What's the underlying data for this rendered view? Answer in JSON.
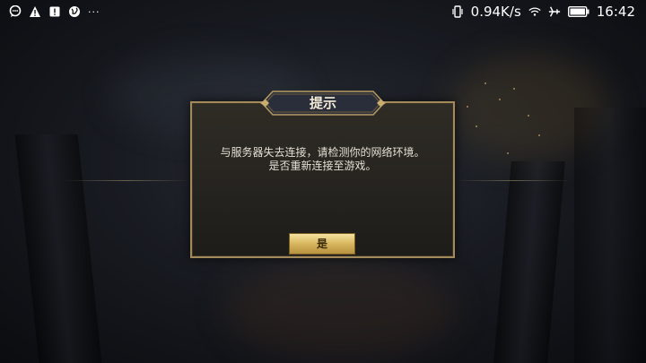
{
  "statusbar": {
    "left_icons": [
      "chat-icon",
      "warning-icon",
      "alert-icon",
      "globe-icon"
    ],
    "more": "···",
    "network_speed": "0.94K/s",
    "time": "16:42"
  },
  "dialog": {
    "title": "提示",
    "message_lines": [
      "与服务器失去连接，请检测你的网络环境。",
      "是否重新连接至游戏。"
    ],
    "confirm_label": "是"
  },
  "colors": {
    "dialog_border": "#a38a5a",
    "button_gold": "#d7b65e",
    "title_bg": "#2a2e3a"
  }
}
